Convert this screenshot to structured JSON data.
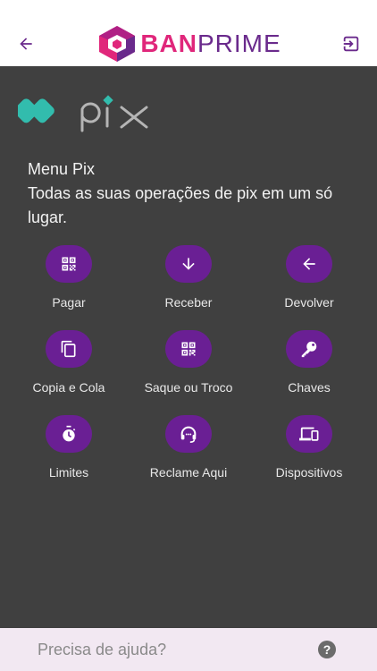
{
  "header": {
    "back_icon": "arrow-left-icon",
    "logout_icon": "logout-icon",
    "brand_primary": "BAN",
    "brand_secondary": "PRIME",
    "brand_pink": "#e0277b",
    "brand_purple": "#6a2a8c"
  },
  "pix": {
    "logo_text": "pix",
    "logo_color": "#32bcad"
  },
  "intro": {
    "line1": "Menu Pix",
    "line2": "Todas as suas operações de pix em um só lugar."
  },
  "menu": {
    "accent": "#6a1f94",
    "items": [
      {
        "label": "Pagar",
        "icon": "qr-code-icon"
      },
      {
        "label": "Receber",
        "icon": "arrow-down-icon"
      },
      {
        "label": "Devolver",
        "icon": "arrow-left-icon"
      },
      {
        "label": "Copia e Cola",
        "icon": "copy-icon"
      },
      {
        "label": "Saque ou Troco",
        "icon": "qr-code-icon"
      },
      {
        "label": "Chaves",
        "icon": "key-icon"
      },
      {
        "label": "Limites",
        "icon": "stopwatch-icon"
      },
      {
        "label": "Reclame Aqui",
        "icon": "headset-icon"
      },
      {
        "label": "Dispositivos",
        "icon": "devices-icon"
      }
    ]
  },
  "footer": {
    "help_text": "Precisa de ajuda?",
    "help_icon": "help-icon",
    "help_glyph": "?"
  }
}
